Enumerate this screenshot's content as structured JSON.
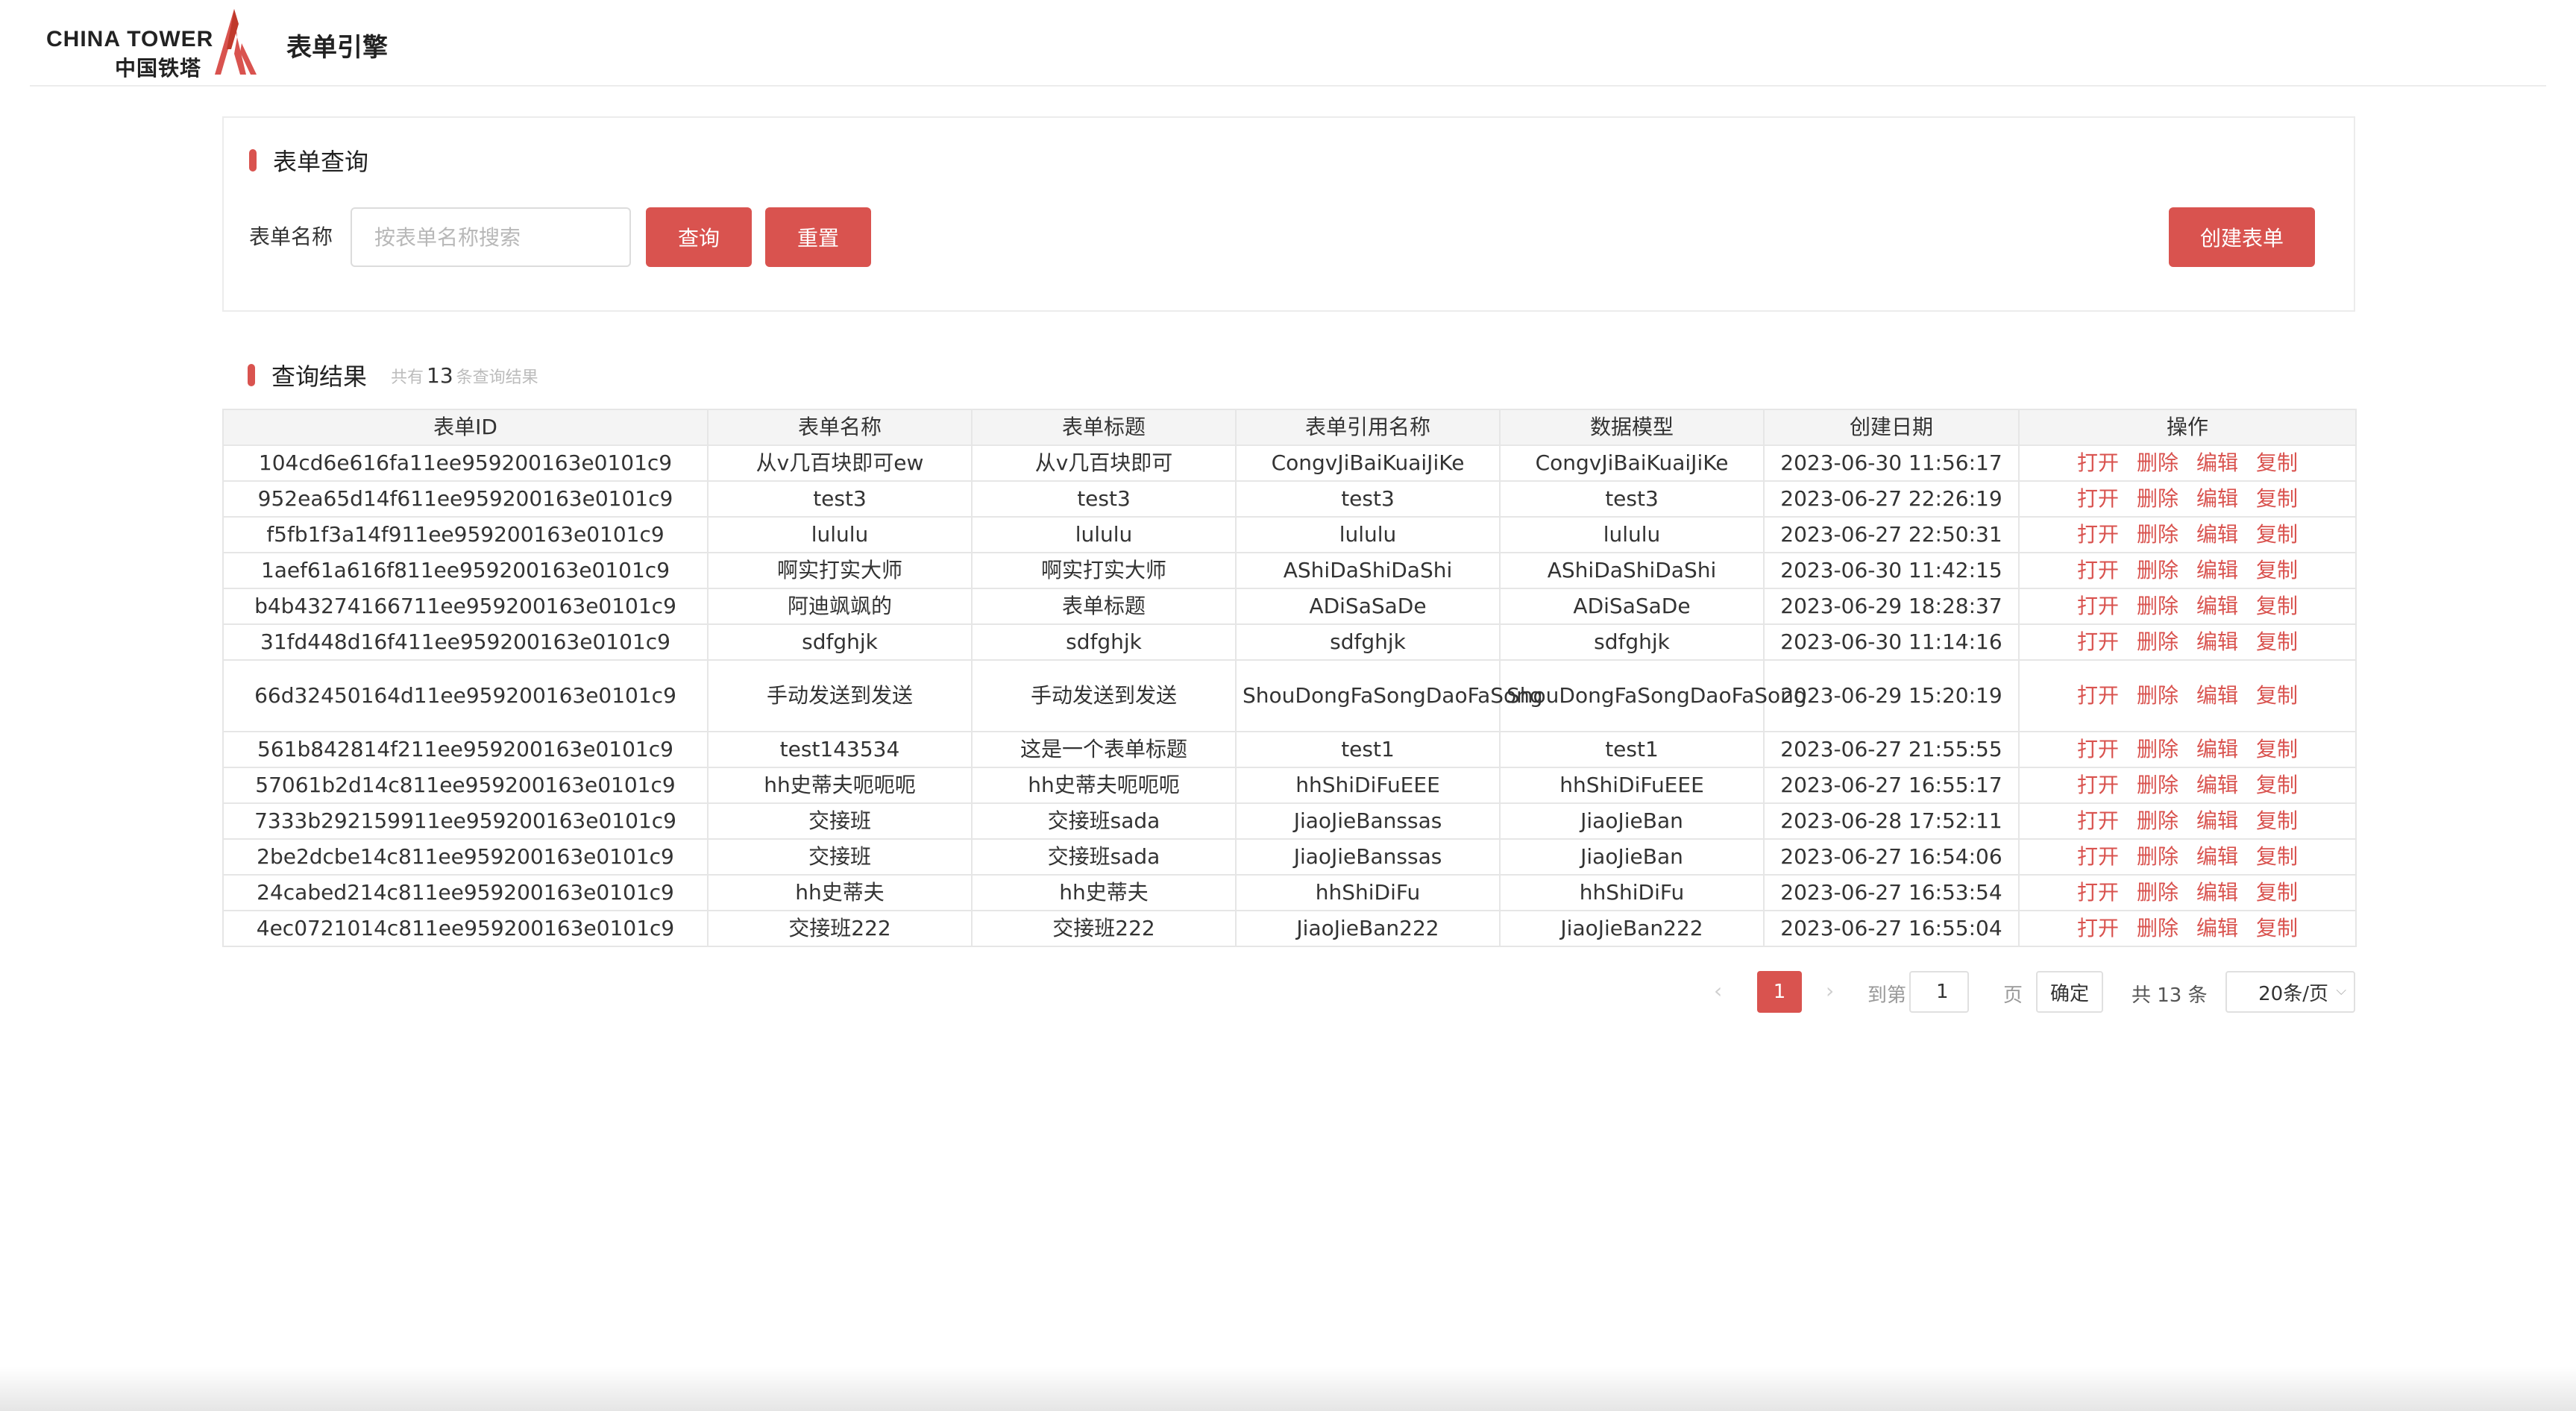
{
  "header": {
    "logo_en": "CHINA TOWER",
    "logo_cn": "中国铁塔",
    "app_title": "表单引擎"
  },
  "query": {
    "section_title": "表单查询",
    "name_label": "表单名称",
    "name_placeholder": "按表单名称搜索",
    "name_value": "",
    "query_button": "查询",
    "reset_button": "重置",
    "create_button": "创建表单"
  },
  "results": {
    "section_title": "查询结果",
    "count_prefix": "共有",
    "count": "13",
    "count_suffix": "条查询结果"
  },
  "table": {
    "headers": [
      "表单ID",
      "表单名称",
      "表单标题",
      "表单引用名称",
      "数据模型",
      "创建日期",
      "操作"
    ],
    "rows": [
      {
        "id": "104cd6e616fa11ee959200163e0101c9",
        "name": "从v几百块即可ew",
        "title": "从v几百块即可",
        "ref": "CongvJiBaiKuaiJiKe",
        "model": "CongvJiBaiKuaiJiKe",
        "date": "2023-06-30 11:56:17"
      },
      {
        "id": "952ea65d14f611ee959200163e0101c9",
        "name": "test3",
        "title": "test3",
        "ref": "test3",
        "model": "test3",
        "date": "2023-06-27 22:26:19"
      },
      {
        "id": "f5fb1f3a14f911ee959200163e0101c9",
        "name": "lululu",
        "title": "lululu",
        "ref": "lululu",
        "model": "lululu",
        "date": "2023-06-27 22:50:31"
      },
      {
        "id": "1aef61a616f811ee959200163e0101c9",
        "name": "啊实打实大师",
        "title": "啊实打实大师",
        "ref": "AShiDaShiDaShi",
        "model": "AShiDaShiDaShi",
        "date": "2023-06-30 11:42:15"
      },
      {
        "id": "b4b43274166711ee959200163e0101c9",
        "name": "阿迪飒飒的",
        "title": "表单标题",
        "ref": "ADiSaSaDe",
        "model": "ADiSaSaDe",
        "date": "2023-06-29 18:28:37"
      },
      {
        "id": "31fd448d16f411ee959200163e0101c9",
        "name": "sdfghjk",
        "title": "sdfghjk",
        "ref": "sdfghjk",
        "model": "sdfghjk",
        "date": "2023-06-30 11:14:16"
      },
      {
        "id": "66d32450164d11ee959200163e0101c9",
        "name": "手动发送到发送",
        "title": "手动发送到发送",
        "ref": "ShouDongFaSongDaoFaSong",
        "model": "ShouDongFaSongDaoFaSong",
        "date": "2023-06-29 15:20:19"
      },
      {
        "id": "561b842814f211ee959200163e0101c9",
        "name": "test143534",
        "title": "这是一个表单标题",
        "ref": "test1",
        "model": "test1",
        "date": "2023-06-27 21:55:55"
      },
      {
        "id": "57061b2d14c811ee959200163e0101c9",
        "name": "hh史蒂夫呃呃呃",
        "title": "hh史蒂夫呃呃呃",
        "ref": "hhShiDiFuEEE",
        "model": "hhShiDiFuEEE",
        "date": "2023-06-27 16:55:17"
      },
      {
        "id": "7333b292159911ee959200163e0101c9",
        "name": "交接班",
        "title": "交接班sada",
        "ref": "JiaoJieBanssas",
        "model": "JiaoJieBan",
        "date": "2023-06-28 17:52:11"
      },
      {
        "id": "2be2dcbe14c811ee959200163e0101c9",
        "name": "交接班",
        "title": "交接班sada",
        "ref": "JiaoJieBanssas",
        "model": "JiaoJieBan",
        "date": "2023-06-27 16:54:06"
      },
      {
        "id": "24cabed214c811ee959200163e0101c9",
        "name": "hh史蒂夫",
        "title": "hh史蒂夫",
        "ref": "hhShiDiFu",
        "model": "hhShiDiFu",
        "date": "2023-06-27 16:53:54"
      },
      {
        "id": "4ec0721014c811ee959200163e0101c9",
        "name": "交接班222",
        "title": "交接班222",
        "ref": "JiaoJieBan222",
        "model": "JiaoJieBan222",
        "date": "2023-06-27 16:55:04"
      }
    ],
    "actions": [
      "打开",
      "删除",
      "编辑",
      "复制"
    ]
  },
  "pagination": {
    "prev_icon": "chevron-left-icon",
    "next_icon": "chevron-right-icon",
    "prev_glyph": "‹",
    "next_glyph": "›",
    "current_page": "1",
    "goto_label": "到第",
    "goto_value": "1",
    "page_label": "页",
    "confirm": "确定",
    "total": "共 13 条",
    "page_size": "20条/页",
    "size_caret": "⌵"
  },
  "colors": {
    "accent": "#d9534f",
    "border": "#e6e6e6",
    "header_bg": "#f4f4f4",
    "text": "#333333"
  }
}
